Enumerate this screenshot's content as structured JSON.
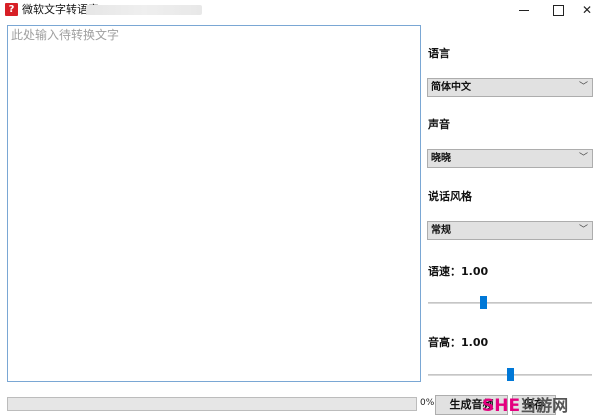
{
  "window": {
    "title": "微软文字转语音V1.0",
    "minimize_icon": "minimize-icon",
    "maximize_icon": "maximize-icon",
    "close_glyph": "✕"
  },
  "editor": {
    "placeholder": "此处输入待转换文字"
  },
  "settings": {
    "language_label": "语言",
    "language_value": "简体中文",
    "voice_label": "声音",
    "voice_value": "晓晓",
    "style_label": "说话风格",
    "style_value": "常规",
    "speed_label": "语速：1.00",
    "speed_value": 1.0,
    "pitch_label": "音高：1.00",
    "pitch_value": 1.0,
    "dropdown_arrow": "﹀"
  },
  "footer": {
    "progress_text": "0%",
    "progress_value": 0,
    "generate_label": "生成音频",
    "save_label": "保存"
  },
  "watermark": {
    "part1": "SHE",
    "part2": "当游网"
  },
  "colors": {
    "accent": "#0078d7",
    "app_icon": "#d71f26",
    "watermark": "#e4007f"
  }
}
